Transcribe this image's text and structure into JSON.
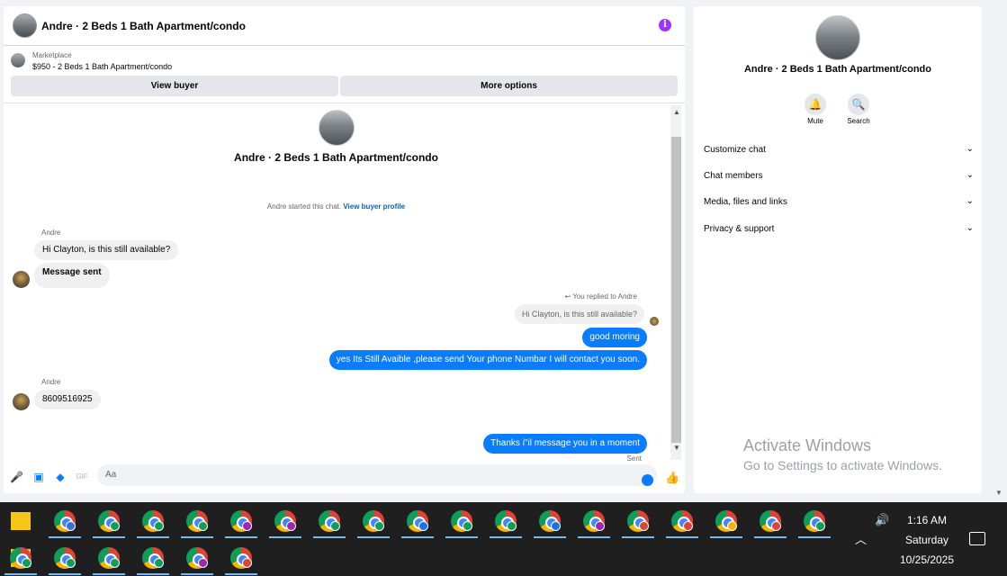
{
  "header": {
    "title": "Andre · 2 Beds 1 Bath Apartment/condo",
    "info_icon": "i"
  },
  "listing": {
    "source": "Marketplace",
    "title": "$950 - 2 Beds 1 Bath Apartment/condo"
  },
  "actions": {
    "view_buyer": "View buyer",
    "more_options": "More options"
  },
  "conversation": {
    "title": "Andre · 2 Beds 1 Bath Apartment/condo",
    "system_note": "Andre started this chat.",
    "system_link": "View buyer profile",
    "messages": [
      {
        "sender": "Andre",
        "text": "Hi Clayton, is this still available?"
      },
      {
        "text": "Message sent"
      },
      {
        "reply_note": "You replied to Andre",
        "quoted": "Hi Clayton, is this still available?"
      },
      {
        "text": "good moring"
      },
      {
        "text": "yes Its Still Avaible ,please send Your phone Numbar I will contact you soon."
      },
      {
        "sender": "Andre",
        "text": "8609516925"
      },
      {
        "text": "Thanks i\"il message you in a moment",
        "status": "Sent"
      }
    ]
  },
  "composer": {
    "placeholder": "Aa"
  },
  "info_panel": {
    "title": "Andre · 2 Beds 1 Bath Apartment/condo",
    "buttons": [
      {
        "label": "Mute",
        "icon": "bell-icon"
      },
      {
        "label": "Search",
        "icon": "search-icon"
      }
    ],
    "sections": [
      "Customize chat",
      "Chat members",
      "Media, files and links",
      "Privacy & support"
    ]
  },
  "watermark": {
    "line1": "Activate Windows",
    "line2": "Go to Settings to activate Windows."
  },
  "taskbar": {
    "time": "1:16 AM",
    "day": "Saturday",
    "date": "10/25/2025"
  },
  "colors": {
    "messenger_blue": "#0a7cff",
    "info_purple": "#a033ff",
    "taskbar": "#1f1f1f"
  }
}
